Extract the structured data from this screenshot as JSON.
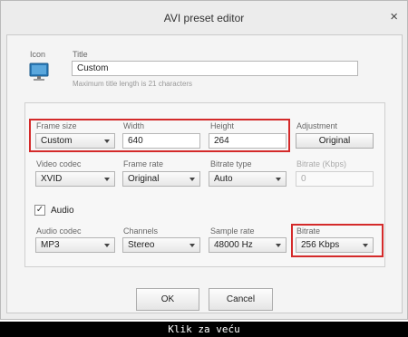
{
  "window": {
    "title": "AVI preset editor",
    "close_symbol": "×"
  },
  "header": {
    "icon_label": "Icon",
    "title_label": "Title",
    "title_value": "Custom",
    "title_hint": "Maximum title length is 21 characters"
  },
  "row1": {
    "frame_size_label": "Frame size",
    "frame_size_value": "Custom",
    "width_label": "Width",
    "width_value": "640",
    "height_label": "Height",
    "height_value": "264",
    "adjustment_label": "Adjustment",
    "adjustment_button": "Original"
  },
  "row2": {
    "video_codec_label": "Video codec",
    "video_codec_value": "XVID",
    "frame_rate_label": "Frame rate",
    "frame_rate_value": "Original",
    "bitrate_type_label": "Bitrate type",
    "bitrate_type_value": "Auto",
    "bitrate_kbps_label": "Bitrate (Kbps)",
    "bitrate_kbps_value": "0"
  },
  "audio": {
    "label": "Audio",
    "checked": true,
    "check_symbol": "✓"
  },
  "row3": {
    "audio_codec_label": "Audio codec",
    "audio_codec_value": "MP3",
    "channels_label": "Channels",
    "channels_value": "Stereo",
    "sample_rate_label": "Sample rate",
    "sample_rate_value": "48000 Hz",
    "bitrate_label": "Bitrate",
    "bitrate_value": "256 Kbps"
  },
  "buttons": {
    "ok": "OK",
    "cancel": "Cancel"
  },
  "caption": "Klik za veću",
  "colors": {
    "highlight": "#d42a2a",
    "icon_blue": "#2a7ab8"
  }
}
